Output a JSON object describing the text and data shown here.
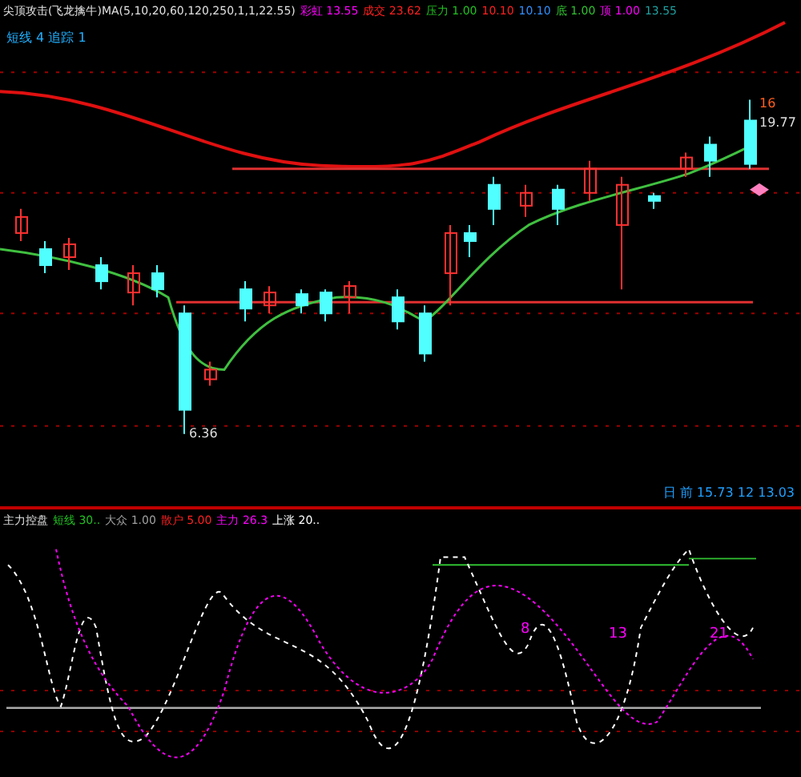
{
  "header": {
    "title": "尖顶攻击(飞龙擒牛)MA(5,10,20,60,120,250,1,1,22.55)",
    "items": [
      {
        "text": "彩虹 13.55",
        "color": "#ff00ff"
      },
      {
        "text": "成交 23.62",
        "color": "#ff2020"
      },
      {
        "text": "压力 1.00",
        "color": "#20c020"
      },
      {
        "text": "10.10",
        "color": "#ff2020"
      },
      {
        "text": "10.10",
        "color": "#3090ff"
      },
      {
        "text": "底 1.00",
        "color": "#30c030"
      },
      {
        "text": "顶 1.00",
        "color": "#ff00ff"
      },
      {
        "text": "13.55",
        "color": "#20a0a0"
      }
    ]
  },
  "subheader": "短线 4 追踪 1",
  "price_labels": [
    {
      "text": "16",
      "kind": "peak"
    },
    {
      "text": "19.77",
      "kind": "high"
    },
    {
      "text": "6.36",
      "kind": "low"
    }
  ],
  "footer": "日 前 15.73 12 13.03",
  "lower_panel": {
    "items": [
      {
        "text": "主力控盘",
        "color": "#e0e0e0"
      },
      {
        "text": "短线 30..",
        "color": "#20c020"
      },
      {
        "text": "大众 1.00",
        "color": "#a0a0a0"
      },
      {
        "text": "散户 5.00",
        "color": "#ff2020"
      },
      {
        "text": "主力 26.3",
        "color": "#ff00ff"
      },
      {
        "text": "上涨 20..",
        "color": "#ffffff"
      }
    ],
    "labels": [
      "8",
      "13",
      "21"
    ]
  }
}
